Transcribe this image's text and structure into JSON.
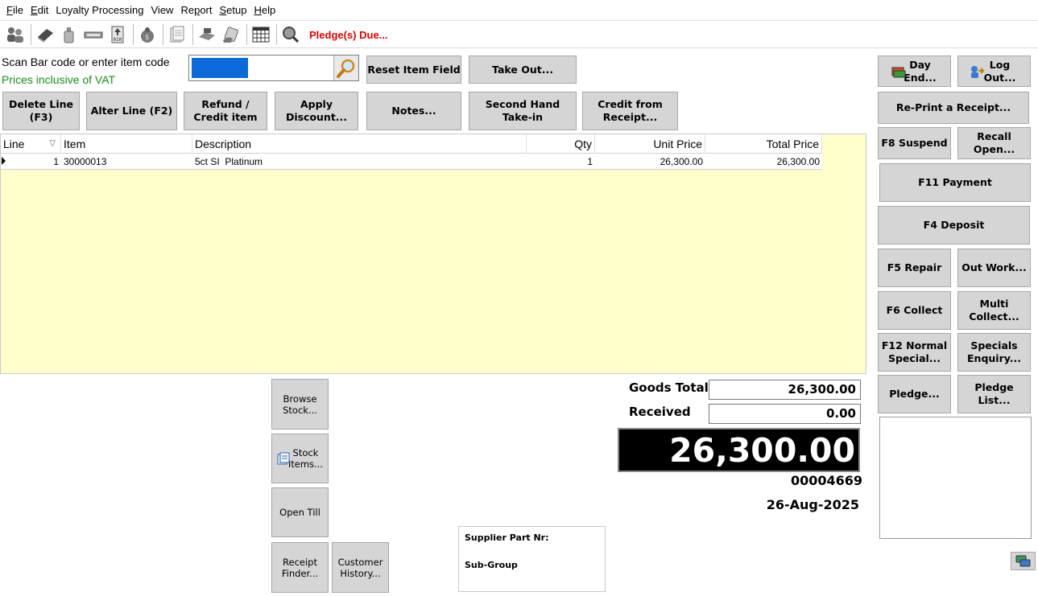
{
  "menu": [
    "File",
    "Edit",
    "Loyalty Processing",
    "View",
    "Report",
    "Setup",
    "Help"
  ],
  "menu_accel": [
    "F",
    "E",
    "",
    "",
    "p",
    "S",
    "H"
  ],
  "toolbar": {
    "icons": [
      "customers-icon",
      "ledger-icon",
      "bottle-icon",
      "tag-icon",
      "barcode-upload-icon",
      "money-bag-icon",
      "documents-icon",
      "cash-register-icon",
      "hand-card-icon",
      "calendar-icon",
      "magnifier-globe-icon"
    ],
    "alert_text": "Pledge(s) Due..."
  },
  "scan": {
    "label": "Scan Bar code or enter item code",
    "vat_label": "Prices inclusive of VAT",
    "value": ""
  },
  "buttons": {
    "reset_item": "Reset Item Field",
    "take_out": "Take Out...",
    "delete_line": "Delete Line\n(F3)",
    "alter_line": "Alter Line (F2)",
    "refund": "Refund /\nCredit item",
    "apply_discount": "Apply\nDiscount...",
    "notes": "Notes...",
    "second_hand": "Second Hand\nTake-in",
    "credit_receipt": "Credit from\nReceipt...",
    "day_end": "Day\nEnd...",
    "log_out": "Log\nOut...",
    "reprint": "Re-Print a Receipt...",
    "suspend": "F8 Suspend",
    "recall": "Recall\nOpen...",
    "payment": "F11 Payment",
    "deposit": "F4 Deposit",
    "repair": "F5 Repair",
    "out_work": "Out Work...",
    "collect": "F6 Collect",
    "multi_collect": "Multi\nCollect...",
    "normal_special": "F12 Normal\nSpecial...",
    "specials_enquiry": "Specials\nEnquiry...",
    "pledge": "Pledge...",
    "pledge_list": "Pledge\nList...",
    "browse_stock": "Browse\nStock...",
    "stock_items": "Stock\nItems...",
    "open_till": "Open Till",
    "receipt_finder": "Receipt\nFinder...",
    "customer_history": "Customer\nHistory..."
  },
  "grid": {
    "columns": [
      "Line",
      "Item",
      "Description",
      "Qty",
      "Unit Price",
      "Total Price"
    ],
    "rows": [
      {
        "line": "1",
        "item": "30000013",
        "description": "5ct SI  Platinum",
        "qty": "1",
        "unit_price": "26,300.00",
        "total_price": "26,300.00"
      }
    ]
  },
  "totals": {
    "goods_total_label": "Goods Total",
    "goods_total": "26,300.00",
    "received_label": "Received",
    "received": "0.00",
    "big_total": "26,300.00",
    "receipt_number": "00004669",
    "date": "26-Aug-2025"
  },
  "supplier_panel": {
    "supplier_part_label": "Supplier Part Nr:",
    "sub_group_label": "Sub-Group"
  },
  "colors": {
    "grid_bg": "#ffffcc",
    "alert": "#e00000",
    "vat_text": "#1a8a1a",
    "button_bg": "#d5d5d5",
    "scan_highlight": "#0a6ad7"
  }
}
